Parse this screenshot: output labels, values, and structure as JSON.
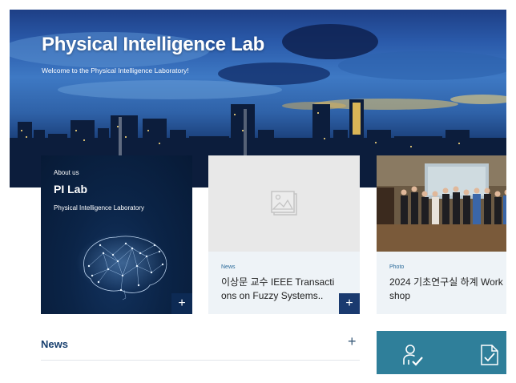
{
  "hero": {
    "title": "Physical Intelligence Lab",
    "subtitle": "Welcome to the Physical Intelligence Laboratory!"
  },
  "cards": {
    "about": {
      "tag": "About us",
      "title": "PI Lab",
      "description": "Physical Intelligence Laboratory",
      "more": "+"
    },
    "news": {
      "category": "News",
      "title": "이상문 교수 IEEE Transacti ons on Fuzzy Systems..",
      "more": "+"
    },
    "photo": {
      "category": "Photo",
      "title": "2024 기초연구실 하계 Work shop"
    }
  },
  "news_section": {
    "heading": "News",
    "more": "+"
  },
  "quick_links": {
    "icons": [
      "person-check-icon",
      "document-check-icon"
    ]
  },
  "colors": {
    "navy": "#0b2447",
    "teal": "#2f7f9a",
    "heading": "#173f6e"
  }
}
